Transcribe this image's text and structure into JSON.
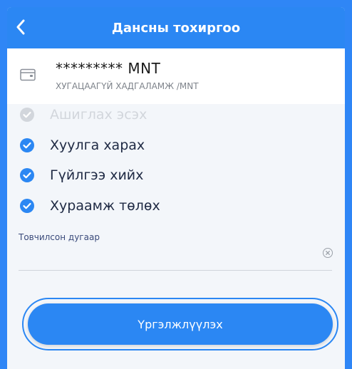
{
  "header": {
    "title": "Дансны тохиргоо",
    "back_icon": "chevron-left-icon"
  },
  "account": {
    "icon": "wallet-icon",
    "number": "********* MNT",
    "type": "ХУГАЦААГҮЙ ХАДГАЛАМЖ /MNT"
  },
  "permissions": [
    {
      "label": "Ашиглах эсэх",
      "checked": true,
      "enabled": false
    },
    {
      "label": "Хуулга харах",
      "checked": true,
      "enabled": true
    },
    {
      "label": "Гүйлгээ хийх",
      "checked": true,
      "enabled": true
    },
    {
      "label": "Хураамж төлөх",
      "checked": true,
      "enabled": true
    }
  ],
  "short_number": {
    "label": "Товчилсон дугаар",
    "value": "",
    "clear_icon": "clear-icon"
  },
  "continue_button": {
    "label": "Үргэлжлүүлэх"
  },
  "colors": {
    "primary": "#2b87f3",
    "check_enabled": "#2b87f3",
    "check_disabled": "#d2d6dc",
    "text": "#1f2a44"
  }
}
